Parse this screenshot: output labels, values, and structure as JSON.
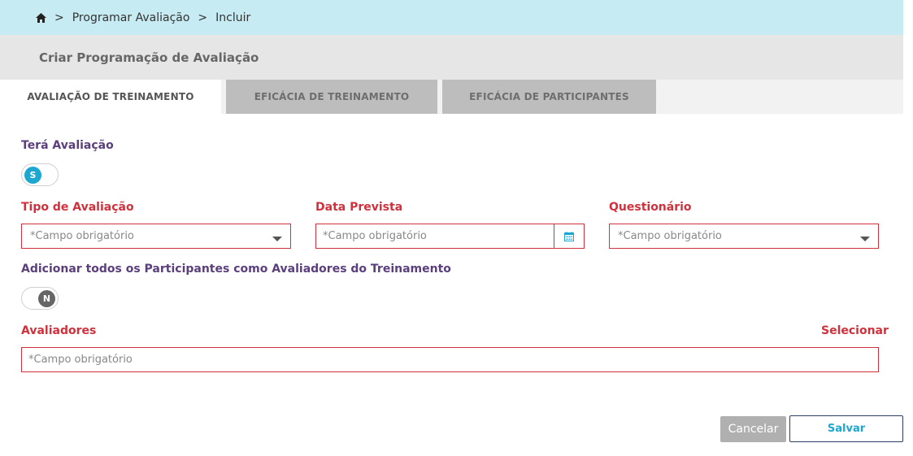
{
  "breadcrumb": {
    "home_icon": "home-icon",
    "separator": ">",
    "items": [
      "Programar Avaliação",
      "Incluir"
    ]
  },
  "page_title": "Criar Programação de Avaliação",
  "tabs": [
    {
      "label": "AVALIAÇÃO DE TREINAMENTO",
      "active": true
    },
    {
      "label": "EFICÁCIA DE TREINAMENTO",
      "active": false
    },
    {
      "label": "EFICÁCIA DE PARTICIPANTES",
      "active": false
    }
  ],
  "form": {
    "tera_avaliacao": {
      "label": "Terá Avaliação",
      "toggle_text": "S",
      "on": true
    },
    "tipo_avaliacao": {
      "label": "Tipo de Avaliação",
      "placeholder": "*Campo obrigatório"
    },
    "data_prevista": {
      "label": "Data Prevista",
      "placeholder": "*Campo obrigatório",
      "icon": "calendar-icon"
    },
    "questionario": {
      "label": "Questionário",
      "placeholder": "*Campo obrigatório"
    },
    "adicionar_participantes": {
      "label": "Adicionar todos os Participantes como Avaliadores do Treinamento",
      "toggle_text": "N",
      "on": false
    },
    "avaliadores": {
      "label": "Avaliadores",
      "select_link": "Selecionar",
      "placeholder": "*Campo obrigatório"
    }
  },
  "actions": {
    "cancel": "Cancelar",
    "save": "Salvar"
  },
  "colors": {
    "breadcrumb_bg": "#c6ebf3",
    "required_red": "#d0313c",
    "label_purple": "#5b3f7d",
    "accent_blue": "#1ba7cf",
    "toggle_off": "#666666"
  }
}
